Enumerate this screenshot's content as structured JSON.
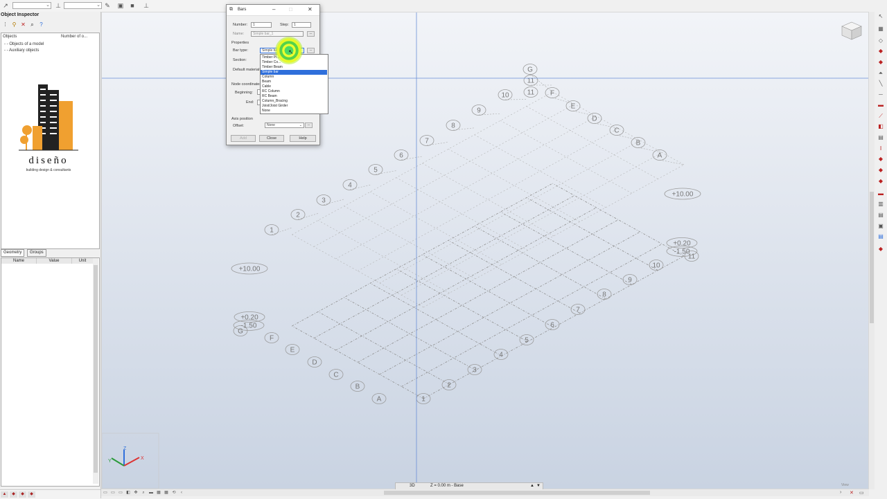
{
  "left_panel": {
    "title": "Object Inspector",
    "tree": {
      "col_objects": "Objects",
      "col_number": "Number of o...",
      "rows": [
        "Objects of a model",
        "Auxiliary objects"
      ]
    },
    "logo": {
      "brand": "diseño",
      "tagline": "building design & consultants"
    },
    "tabs": [
      "Geometry",
      "Groups"
    ],
    "props_headers": [
      "Name",
      "Value",
      "Unit"
    ]
  },
  "dialog": {
    "title": "Bars",
    "number_label": "Number:",
    "number_value": "1",
    "step_label": "Step:",
    "step_value": "1",
    "name_label": "Name:",
    "name_value": "Simple bar_1",
    "properties_label": "Properties",
    "bar_type_label": "Bar type:",
    "bar_type_value": "Simple bar",
    "section_label": "Section:",
    "default_material_label": "Default material",
    "node_coords_label": "Node coordinates",
    "beginning_label": "Beginning:",
    "end_label": "End:",
    "axis_position_label": "Axis position",
    "offset_label": "Offset:",
    "offset_value": "None",
    "add_button": "Add",
    "close_button": "Close",
    "help_button": "Help"
  },
  "dropdown": {
    "options": [
      "Timber Pl...",
      "Timber Co...",
      "Timber Beam",
      "Simple bar",
      "Column",
      "Beam",
      "Cable",
      "RC Column",
      "RC Beam",
      "Column_Bracing",
      "Joist/Joist Girder",
      "None"
    ],
    "selected_index": 3
  },
  "viewport": {
    "letter_axes": [
      "A",
      "B",
      "C",
      "D",
      "E",
      "F",
      "G"
    ],
    "number_axes": [
      "1",
      "2",
      "3",
      "4",
      "5",
      "6",
      "7",
      "8",
      "9",
      "10",
      "11"
    ],
    "levels": {
      "top": "+10.00",
      "mid": "+0.20",
      "base": "-1.50"
    },
    "axis_triad": {
      "x": "X",
      "y": "Y",
      "z": "Z"
    }
  },
  "status": {
    "view": "3D",
    "level": "Z = 0.00 m - Base",
    "corner": "View"
  },
  "colors": {
    "accent": "#2f6fdb",
    "grid": "#8f8f8f",
    "selection_line": "#6a8fd6",
    "cursor": "#c9f02a"
  }
}
